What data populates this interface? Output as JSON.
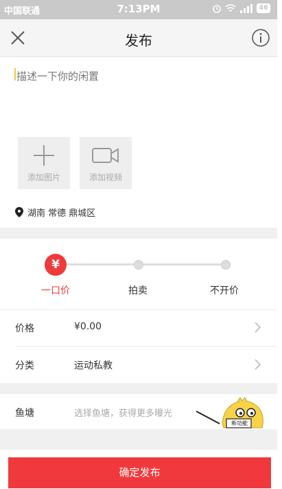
{
  "status_bar": {
    "carrier": "中国联通",
    "time": "7:13PM",
    "battery": "46"
  },
  "header": {
    "title": "发布",
    "close_icon": "close-icon",
    "info_icon": "info-icon"
  },
  "description": {
    "placeholder": "描述一下你的闲置"
  },
  "media": {
    "add_image_label": "添加图片",
    "add_video_label": "添加视频"
  },
  "location": {
    "text": "湖南 常德 鼎城区"
  },
  "price_mode": {
    "options": [
      "一口价",
      "拍卖",
      "不开价"
    ],
    "selected_index": 0,
    "selected_symbol": "¥",
    "active_color": "#ee3a3a"
  },
  "form": {
    "price": {
      "label": "价格",
      "value": "¥0.00"
    },
    "category": {
      "label": "分类",
      "value": "运动私教"
    },
    "pond": {
      "label": "鱼塘",
      "placeholder": "选择鱼塘，获得更多曝光",
      "badge": "新功能"
    }
  },
  "submit": {
    "label": "确定发布",
    "color": "#f0393c"
  }
}
